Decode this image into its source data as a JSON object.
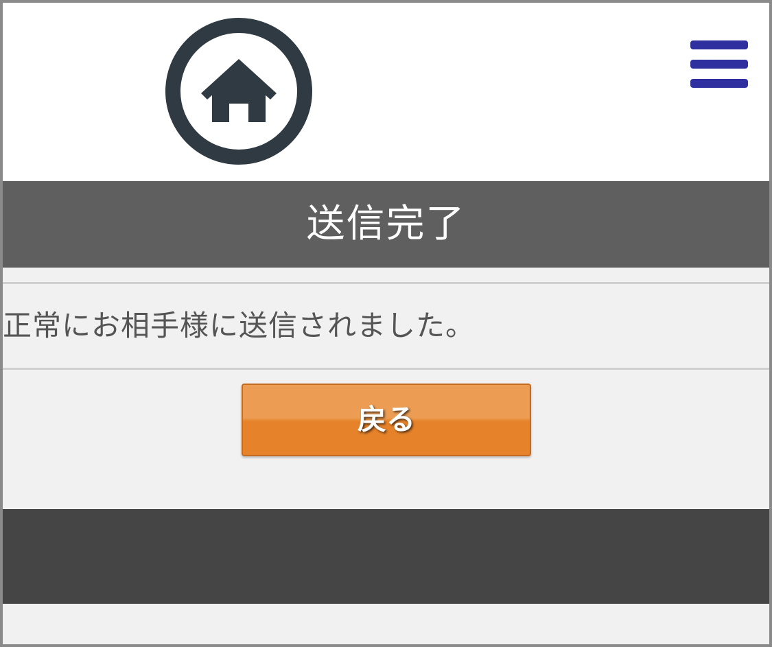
{
  "header": {
    "home_icon": "home-circle-icon",
    "menu_icon": "hamburger-menu-icon",
    "menu_icon_color": "#2f2fa0"
  },
  "title_bar": {
    "title": "送信完了"
  },
  "message": {
    "text": "正常にお相手様に送信されました。"
  },
  "actions": {
    "back_label": "戻る",
    "back_color": "#e6832a"
  },
  "colors": {
    "title_bar_bg": "#5f5f5f",
    "footer_bg": "#454545",
    "page_bg": "#f1f1f1"
  }
}
